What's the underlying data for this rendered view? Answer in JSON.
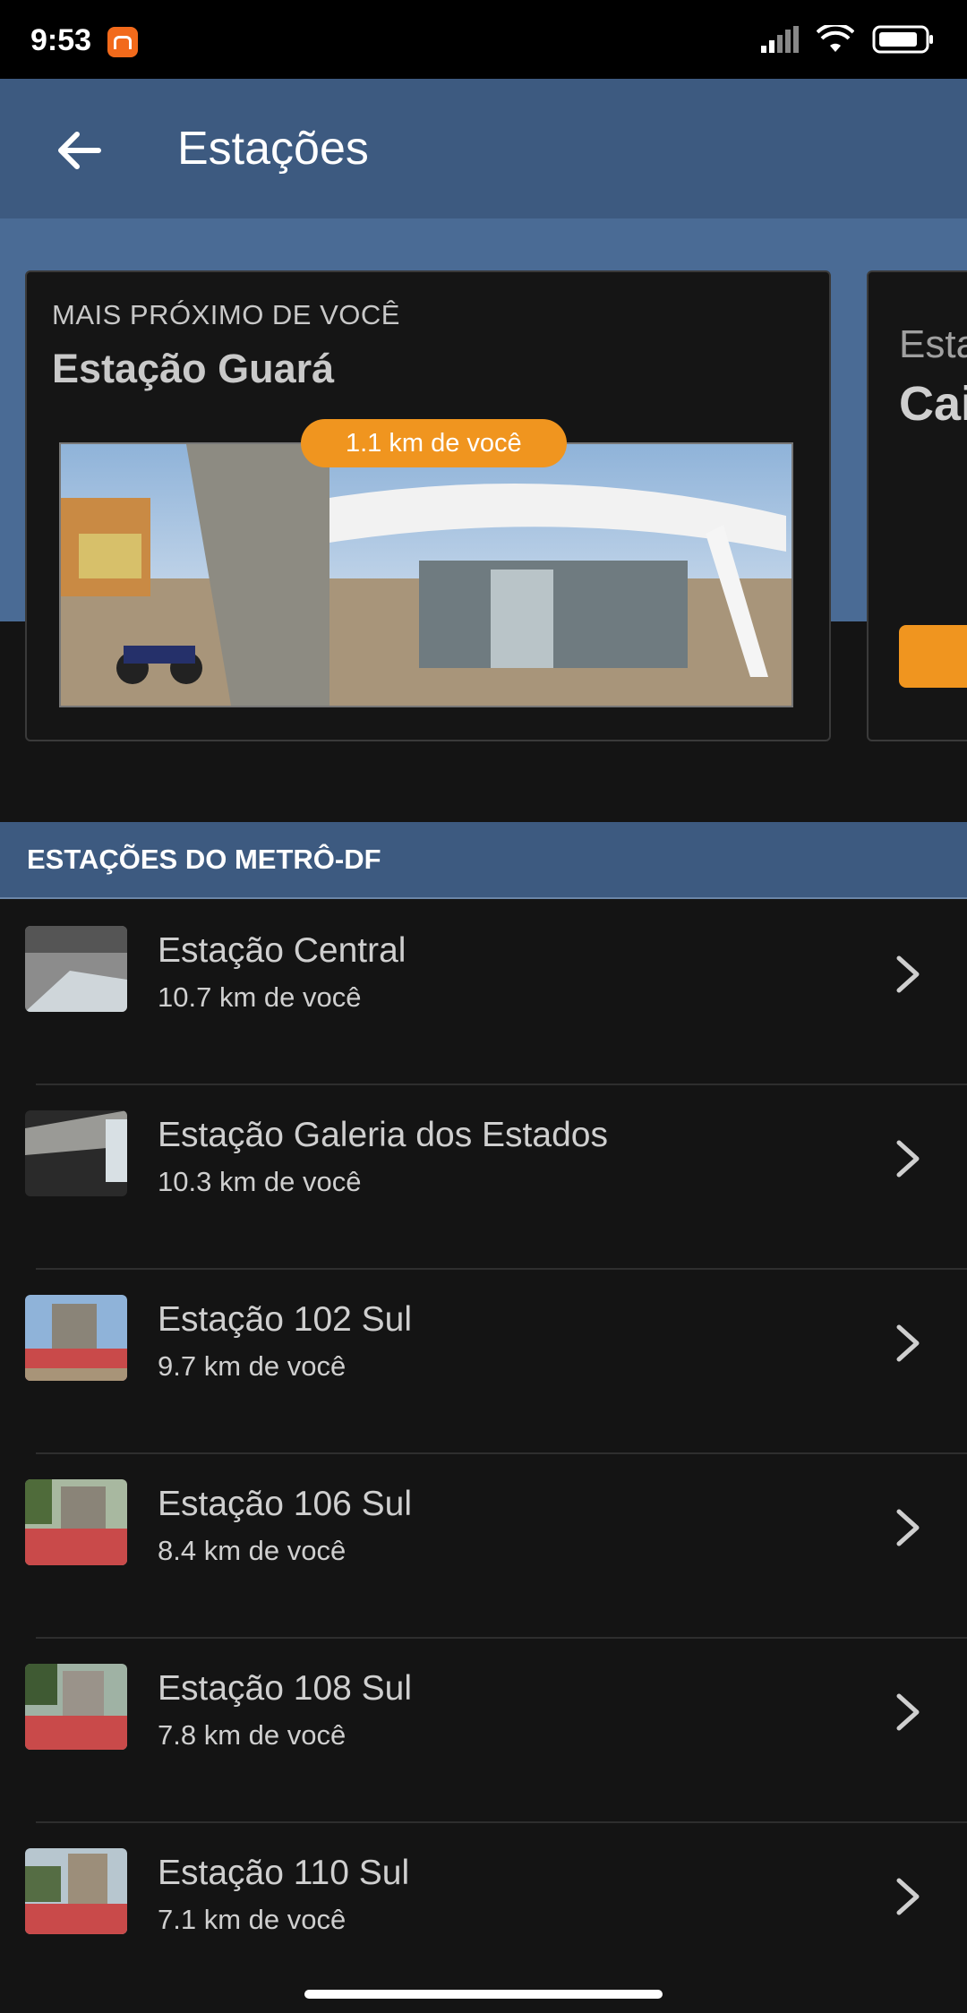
{
  "status": {
    "time": "9:53"
  },
  "app_bar": {
    "title": "Estações"
  },
  "nearest": {
    "kicker": "MAIS PRÓXIMO DE VOCÊ",
    "title": "Estação Guará",
    "distance": "1.1 km de você"
  },
  "next_card": {
    "kicker": "Esta",
    "title": "Cai"
  },
  "section": {
    "title": "ESTAÇÕES DO METRÔ-DF"
  },
  "stations": [
    {
      "name": "Estação Central",
      "distance": "10.7 km de você"
    },
    {
      "name": "Estação Galeria dos Estados",
      "distance": "10.3 km de você"
    },
    {
      "name": "Estação 102 Sul",
      "distance": "9.7 km de você"
    },
    {
      "name": "Estação 106 Sul",
      "distance": "8.4 km de você"
    },
    {
      "name": "Estação 108 Sul",
      "distance": "7.8 km de você"
    },
    {
      "name": "Estação 110 Sul",
      "distance": "7.1 km de você"
    }
  ],
  "colors": {
    "header": "#3d5a80",
    "accent": "#f0951f",
    "background": "#141414"
  }
}
